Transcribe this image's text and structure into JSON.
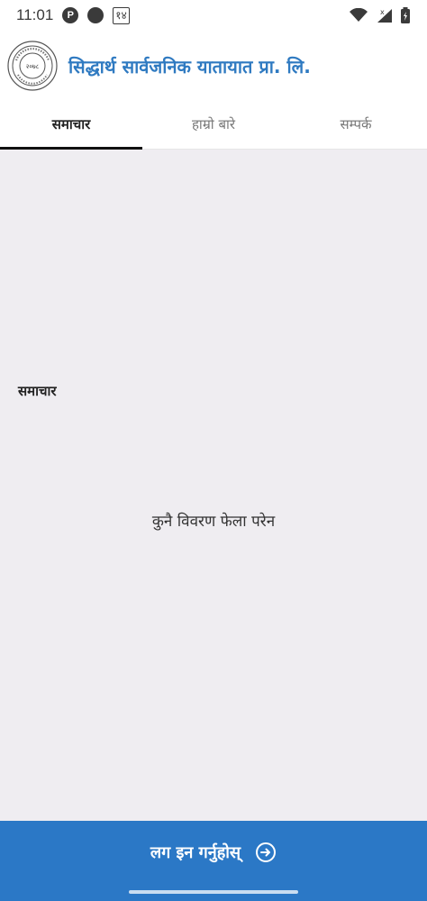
{
  "status_bar": {
    "time": "11:01",
    "notification_badge": "P",
    "notification_box": "१४"
  },
  "app": {
    "title": "सिद्धार्थ सार्वजनिक यातायात प्रा. लि.",
    "logo_year": "२०७८",
    "brand_color": "#2f7ac1"
  },
  "tabs": [
    {
      "label": "समाचार",
      "active": true
    },
    {
      "label": "हाम्रो बारे",
      "active": false
    },
    {
      "label": "सम्पर्क",
      "active": false
    }
  ],
  "content": {
    "section_heading": "समाचार",
    "empty_message": "कुनै विवरण फेला परेन"
  },
  "login": {
    "label": "लग इन गर्नुहोस्",
    "icon": "arrow-right-circle-icon",
    "background_color": "#2b78c6"
  }
}
